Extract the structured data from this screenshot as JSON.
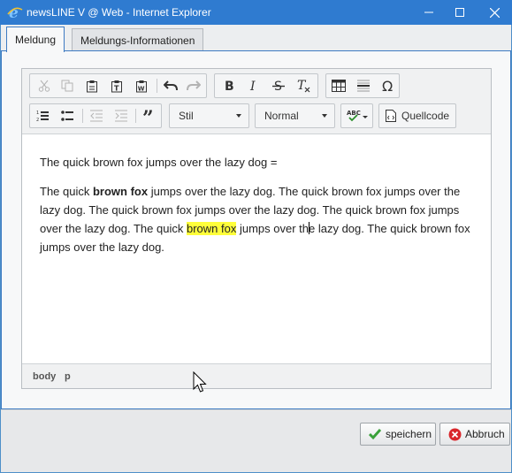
{
  "window": {
    "title": "newsLINE V @ Web - Internet Explorer",
    "icons": [
      "ie-icon",
      "minimize-icon",
      "maximize-icon",
      "close-icon"
    ]
  },
  "tabs": [
    {
      "label": "Meldung",
      "active": true
    },
    {
      "label": "Meldungs-Informationen",
      "active": false
    }
  ],
  "toolbar": {
    "style_dropdown": "Stil",
    "format_dropdown": "Normal",
    "source_button": "Quellcode",
    "icons": [
      "cut-icon",
      "copy-icon",
      "paste-icon",
      "paste-text-icon",
      "paste-word-icon",
      "undo-icon",
      "redo-icon",
      "bold-icon",
      "italic-icon",
      "strikethrough-icon",
      "remove-format-icon",
      "table-icon",
      "horizontal-rule-icon",
      "special-char-icon",
      "numbered-list-icon",
      "bulleted-list-icon",
      "outdent-icon",
      "indent-icon",
      "blockquote-icon",
      "spellcheck-icon",
      "source-icon"
    ]
  },
  "content": {
    "para1": "The quick brown fox jumps over the lazy dog =",
    "para2": {
      "t1": "The quick ",
      "b1": "brown fox",
      "t2": " jumps over the lazy dog. The quick brown fox jumps over the lazy dog. The quick brown fox jumps over the lazy dog. The quick brown fox jumps over the lazy dog. The quick ",
      "hl": "brown fox",
      "t3": " jumps over th",
      "t4": "e lazy dog. The quick brown fox jumps over the lazy dog."
    }
  },
  "pathbar": {
    "items": [
      "body",
      "p"
    ]
  },
  "buttons": {
    "save": "speichern",
    "cancel": "Abbruch"
  },
  "colors": {
    "titlebar": "#2f7bd0",
    "highlight": "#ffff3a",
    "save_icon": "#3aa13a",
    "cancel_icon": "#d9262b"
  }
}
